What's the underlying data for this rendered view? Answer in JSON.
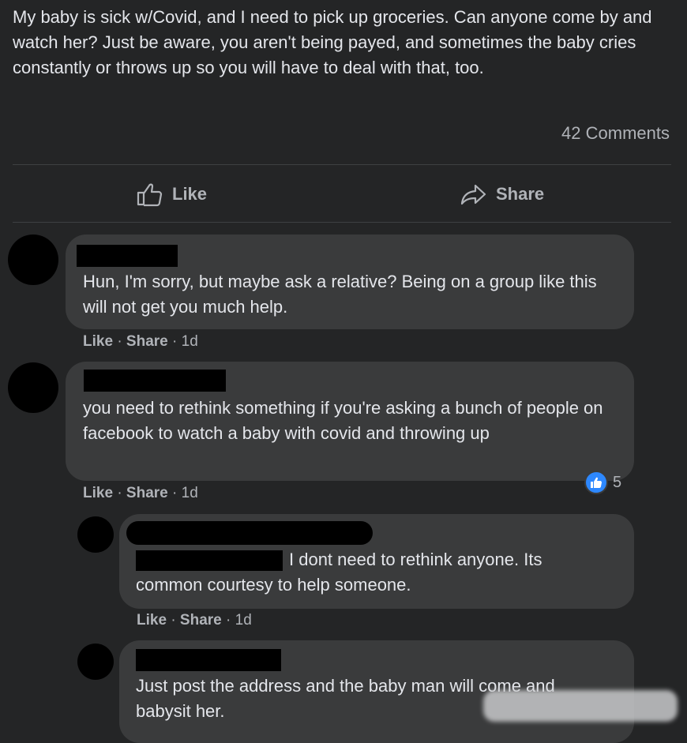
{
  "post": {
    "text": "My baby is sick w/Covid, and I need to pick up groceries. Can anyone come by and watch her? Just be aware, you aren't being payed, and sometimes the baby cries constantly or throws up so you will have to deal with that, too.",
    "comment_count": "42 Comments"
  },
  "actions": {
    "like_label": "Like",
    "share_label": "Share"
  },
  "comments": [
    {
      "text": "Hun, I'm sorry, but maybe ask a relative? Being on a group like this will not get you much help.",
      "like": "Like",
      "share": "Share",
      "time": "1d"
    },
    {
      "text": "you need to rethink something if you're asking a bunch of people on facebook to watch a baby with covid and throwing up",
      "like": "Like",
      "share": "Share",
      "time": "1d",
      "reaction_count": "5"
    },
    {
      "text_after_tag": "I dont need to rethink anyone. Its",
      "text_line2": "common courtesy to help someone.",
      "like": "Like",
      "share": "Share",
      "time": "1d"
    },
    {
      "text": "Just post the address and the baby man will come and babysit her."
    }
  ],
  "colors": {
    "background": "#242526",
    "bubble": "#3a3b3c",
    "text": "#e4e6eb",
    "secondary_text": "#b0b3b8",
    "like_badge": "#2d88ff"
  }
}
